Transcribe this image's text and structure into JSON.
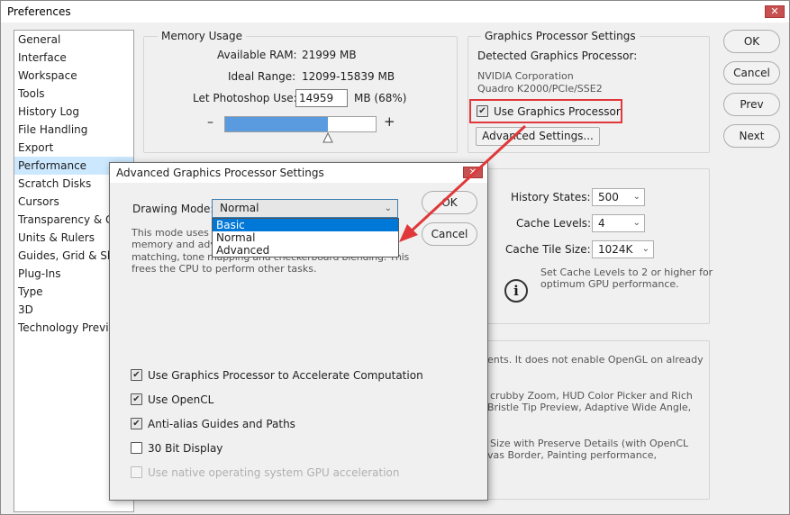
{
  "window": {
    "title": "Preferences",
    "close_glyph": "✕"
  },
  "nav": {
    "items": [
      "General",
      "Interface",
      "Workspace",
      "Tools",
      "History Log",
      "File Handling",
      "Export",
      "Performance",
      "Scratch Disks",
      "Cursors",
      "Transparency & Gamut",
      "Units & Rulers",
      "Guides, Grid & Slices",
      "Plug-Ins",
      "Type",
      "3D",
      "Technology Previews"
    ],
    "selected": "Performance"
  },
  "memory": {
    "title": "Memory Usage",
    "available_label": "Available RAM:",
    "available_value": "21999 MB",
    "ideal_label": "Ideal Range:",
    "ideal_value": "12099-15839 MB",
    "let_label": "Let Photoshop Use:",
    "let_value": "14959",
    "let_suffix": "MB (68%)",
    "minus": "–",
    "plus": "+",
    "slider_fraction": 0.68
  },
  "gpu": {
    "title": "Graphics Processor Settings",
    "detected_label": "Detected Graphics Processor:",
    "vendor": "NVIDIA Corporation",
    "model": "Quadro K2000/PCIe/SSE2",
    "use_gpu_label": "Use Graphics Processor",
    "use_gpu_checked": true,
    "advanced_button": "Advanced Settings..."
  },
  "history": {
    "states_label": "History States:",
    "states_value": "500",
    "cache_label": "Cache Levels:",
    "cache_value": "4",
    "tile_label": "Cache Tile Size:",
    "tile_value": "1024K",
    "info_line1": "Set Cache Levels to 2 or higher for",
    "info_line2": "optimum GPU performance."
  },
  "description": {
    "line1": "ents. It does not enable OpenGL on already",
    "line2": "crubby Zoom, HUD Color Picker and Rich",
    "line3": "Bristle Tip Preview, Adaptive Wide Angle,",
    "line4": "Size with Preserve Details (with OpenCL",
    "line5": "vas Border, Painting performance,"
  },
  "buttons": {
    "ok": "OK",
    "cancel": "Cancel",
    "prev": "Prev",
    "next": "Next"
  },
  "dialog": {
    "title": "Advanced Graphics Processor Settings",
    "close_glyph": "✕",
    "drawing_mode_label": "Drawing Mode:",
    "drawing_mode_value": "Normal",
    "options": [
      "Basic",
      "Normal",
      "Advanced"
    ],
    "highlighted_option": "Basic",
    "desc_line1": "This mode uses a",
    "desc_line2": "memory and adva",
    "desc_line3": "matching, tone mapping and checkerboard blending. This",
    "desc_line4": "frees the CPU to perform other tasks.",
    "ok": "OK",
    "cancel": "Cancel",
    "checks": [
      {
        "label": "Use Graphics Processor to Accelerate Computation",
        "checked": true,
        "enabled": true
      },
      {
        "label": "Use OpenCL",
        "checked": true,
        "enabled": true
      },
      {
        "label": "Anti-alias Guides and Paths",
        "checked": true,
        "enabled": true
      },
      {
        "label": "30 Bit Display",
        "checked": false,
        "enabled": true
      },
      {
        "label": "Use native operating system GPU acceleration",
        "checked": false,
        "enabled": false
      }
    ]
  },
  "icons": {
    "check": "✔",
    "chevron": "⌄",
    "info": "i"
  },
  "colors": {
    "selection": "#cce8ff",
    "highlight_box": "#e0383a",
    "dropdown_highlight": "#0078d7",
    "slider_fill": "#5a9be0"
  }
}
